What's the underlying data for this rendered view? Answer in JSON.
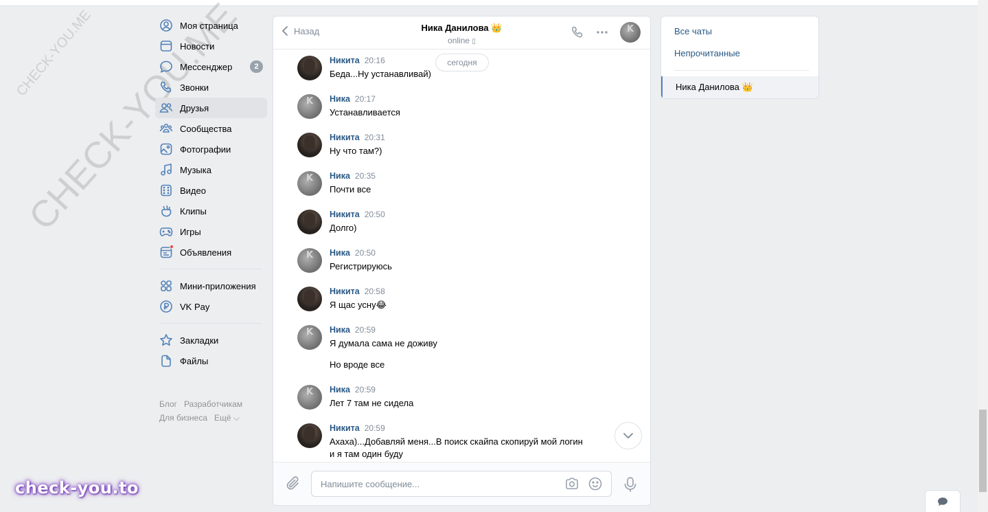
{
  "nav": {
    "items": [
      {
        "label": "Моя страница",
        "icon": "user-circle-icon"
      },
      {
        "label": "Новости",
        "icon": "newspaper-icon"
      },
      {
        "label": "Мессенджер",
        "icon": "message-bubble-icon",
        "badge": "2"
      },
      {
        "label": "Звонки",
        "icon": "phone-icon"
      },
      {
        "label": "Друзья",
        "icon": "friends-icon",
        "active": true
      },
      {
        "label": "Сообщества",
        "icon": "communities-icon"
      },
      {
        "label": "Фотографии",
        "icon": "photo-icon"
      },
      {
        "label": "Музыка",
        "icon": "music-note-icon"
      },
      {
        "label": "Видео",
        "icon": "video-icon"
      },
      {
        "label": "Клипы",
        "icon": "clips-icon"
      },
      {
        "label": "Игры",
        "icon": "gamepad-icon"
      },
      {
        "label": "Объявления",
        "icon": "ads-icon"
      },
      {
        "label": "Мини-приложения",
        "icon": "apps-grid-icon"
      },
      {
        "label": "VK Pay",
        "icon": "vk-pay-icon"
      },
      {
        "label": "Закладки",
        "icon": "star-icon"
      },
      {
        "label": "Файлы",
        "icon": "file-icon"
      }
    ],
    "footer": [
      "Блог",
      "Разработчикам",
      "Для бизнеса",
      "Ещё ⌵"
    ]
  },
  "chat": {
    "back_label": "Назад",
    "peer_name": "Ника Данилова 👑",
    "peer_status": "online",
    "date_label": "сегодня",
    "messages": [
      {
        "author": "Никита",
        "time": "20:16",
        "text": "Беда...Ну устанавливай)"
      },
      {
        "author": "Ника",
        "time": "20:17",
        "text": "Устанавливается"
      },
      {
        "author": "Никита",
        "time": "20:31",
        "text": "Ну что там?)"
      },
      {
        "author": "Ника",
        "time": "20:35",
        "text": "Почти все"
      },
      {
        "author": "Никита",
        "time": "20:50",
        "text": "Долго)"
      },
      {
        "author": "Ника",
        "time": "20:50",
        "text": "Регистрируюсь"
      },
      {
        "author": "Никита",
        "time": "20:58",
        "text": "Я щас усну😂"
      },
      {
        "author": "Ника",
        "time": "20:59",
        "text": "Я думала сама не доживу",
        "text2": "Но вроде все"
      },
      {
        "author": "Ника",
        "time": "20:59",
        "text": "Лет 7 там не сидела"
      },
      {
        "author": "Никита",
        "time": "20:59",
        "text": "Ахаха)...Добавляй меня...В поиск скайпа скопируй мой логин",
        "text_line2": "и я там один буду"
      }
    ],
    "composer_placeholder": "Напишите сообщение..."
  },
  "right_panel": {
    "filters": [
      "Все чаты",
      "Непрочитанные"
    ],
    "active_chat": "Ника Данилова 👑"
  },
  "watermarks": {
    "small": "CHECK-YOU.ME",
    "large": "CHECK-YOU.ME",
    "logo": "check-you.to"
  },
  "colors": {
    "background": "#edeef0",
    "link": "#2a5885",
    "accent": "#5181b8",
    "secondary_text": "#818c99"
  }
}
